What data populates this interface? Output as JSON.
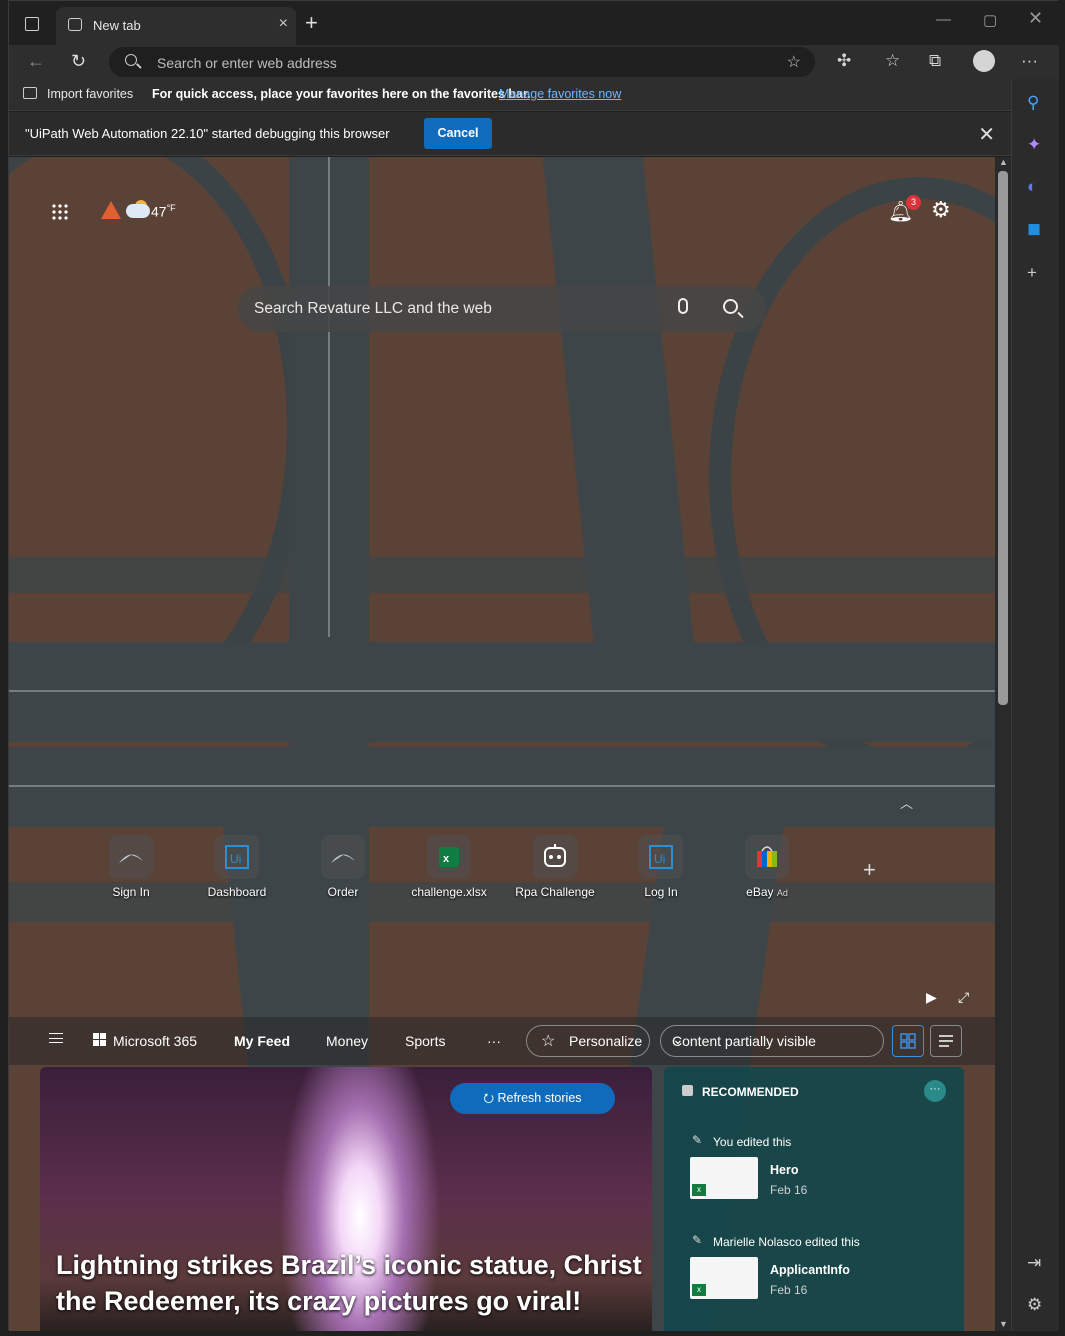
{
  "browser": {
    "tab_title": "New tab",
    "address_placeholder": "Search or enter web address"
  },
  "favorites_bar": {
    "import_label": "Import favorites",
    "message": "For quick access, place your favorites here on the favorites bar.",
    "link": "Manage favorites now"
  },
  "debug_bar": {
    "message": "\"UiPath Web Automation 22.10\" started debugging this browser",
    "cancel_label": "Cancel"
  },
  "ntp": {
    "temperature": "47",
    "temperature_unit": "°F",
    "notification_count": "3",
    "search_placeholder": "Search Revature LLC and the web"
  },
  "quick_links": [
    {
      "label": "Sign In",
      "icon": "bird-icon"
    },
    {
      "label": "Dashboard",
      "icon": "uipath-icon"
    },
    {
      "label": "Order",
      "icon": "bird-icon"
    },
    {
      "label": "challenge.xlsx",
      "icon": "excel-icon"
    },
    {
      "label": "Rpa Challenge",
      "icon": "robot-icon"
    },
    {
      "label": "Log In",
      "icon": "uipath-icon"
    },
    {
      "label": "eBay",
      "ad": "Ad",
      "icon": "ebay-bag-icon"
    }
  ],
  "feed_nav": {
    "ms365": "Microsoft 365",
    "my_feed": "My Feed",
    "money": "Money",
    "sports": "Sports",
    "more": "···",
    "personalize": "Personalize",
    "visibility": "Content partially visible"
  },
  "hero": {
    "refresh_label": "Refresh stories",
    "headline": "Lightning strikes Brazil’s iconic statue, Christ the Redeemer, its crazy pictures go viral!"
  },
  "recommended": {
    "title": "RECOMMENDED",
    "items": [
      {
        "activity": "You edited this",
        "name": "Hero",
        "date": "Feb 16"
      },
      {
        "activity": "Marielle Nolasco edited this",
        "name": "ApplicantInfo",
        "date": "Feb 16"
      }
    ]
  },
  "colors": {
    "accent": "#0f6cbd",
    "badge": "#d9343b",
    "excel": "#107c41"
  }
}
